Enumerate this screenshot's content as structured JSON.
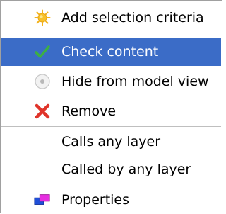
{
  "menu": {
    "items": [
      {
        "label": "Add selection criteria",
        "icon": "sun-icon"
      },
      {
        "label": "Check content",
        "icon": "checkmark-icon",
        "selected": true
      },
      {
        "label": "Hide from model view",
        "icon": "hide-icon"
      },
      {
        "label": "Remove",
        "icon": "red-x-icon"
      },
      {
        "label": "Calls any layer"
      },
      {
        "label": "Called by any layer"
      },
      {
        "label": "Properties",
        "icon": "properties-icon"
      }
    ]
  },
  "colors": {
    "selection": "#3b6cc7",
    "check": "#3cb043",
    "remove": "#e0342a",
    "sun": "#f7c12a"
  }
}
